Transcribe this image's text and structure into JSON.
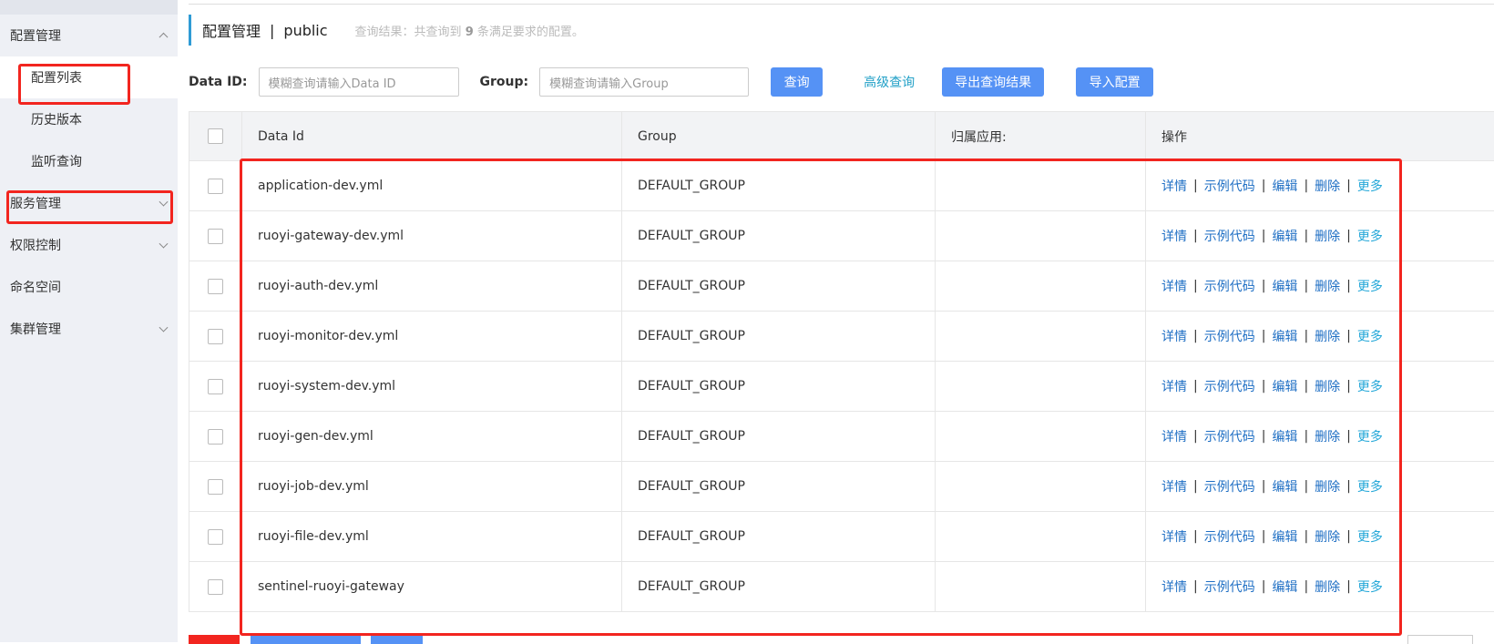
{
  "sidebar": {
    "groups": [
      {
        "label": "配置管理",
        "expanded": true,
        "items": [
          {
            "label": "配置列表",
            "active": true
          },
          {
            "label": "历史版本"
          },
          {
            "label": "监听查询"
          }
        ]
      },
      {
        "label": "服务管理",
        "expanded": false
      },
      {
        "label": "权限控制",
        "expanded": false
      },
      {
        "label": "命名空间"
      },
      {
        "label": "集群管理",
        "expanded": false
      }
    ]
  },
  "header": {
    "title": "配置管理",
    "separator": "|",
    "namespace": "public",
    "result_prefix": "查询结果：共查询到",
    "result_count": "9",
    "result_suffix": "条满足要求的配置。"
  },
  "search": {
    "dataid_label": "Data ID:",
    "dataid_placeholder": "模糊查询请输入Data ID",
    "group_label": "Group:",
    "group_placeholder": "模糊查询请输入Group",
    "query_button": "查询",
    "advanced_link": "高级查询",
    "export_button": "导出查询结果",
    "import_button": "导入配置"
  },
  "table": {
    "headers": {
      "data_id": "Data Id",
      "group": "Group",
      "app": "归属应用:",
      "ops": "操作"
    },
    "ops": {
      "detail": "详情",
      "sample": "示例代码",
      "edit": "编辑",
      "delete": "删除",
      "more": "更多",
      "sep": "|"
    },
    "rows": [
      {
        "data_id": "application-dev.yml",
        "group": "DEFAULT_GROUP",
        "app": ""
      },
      {
        "data_id": "ruoyi-gateway-dev.yml",
        "group": "DEFAULT_GROUP",
        "app": ""
      },
      {
        "data_id": "ruoyi-auth-dev.yml",
        "group": "DEFAULT_GROUP",
        "app": ""
      },
      {
        "data_id": "ruoyi-monitor-dev.yml",
        "group": "DEFAULT_GROUP",
        "app": ""
      },
      {
        "data_id": "ruoyi-system-dev.yml",
        "group": "DEFAULT_GROUP",
        "app": ""
      },
      {
        "data_id": "ruoyi-gen-dev.yml",
        "group": "DEFAULT_GROUP",
        "app": ""
      },
      {
        "data_id": "ruoyi-job-dev.yml",
        "group": "DEFAULT_GROUP",
        "app": ""
      },
      {
        "data_id": "ruoyi-file-dev.yml",
        "group": "DEFAULT_GROUP",
        "app": ""
      },
      {
        "data_id": "sentinel-ruoyi-gateway",
        "group": "DEFAULT_GROUP",
        "app": ""
      }
    ]
  },
  "colors": {
    "primary_button": "#5592f5",
    "link": "#1f6fc4",
    "more_link": "#23a7d8",
    "annotation": "#f2251f",
    "sidebar_bg": "#eef0f5"
  }
}
